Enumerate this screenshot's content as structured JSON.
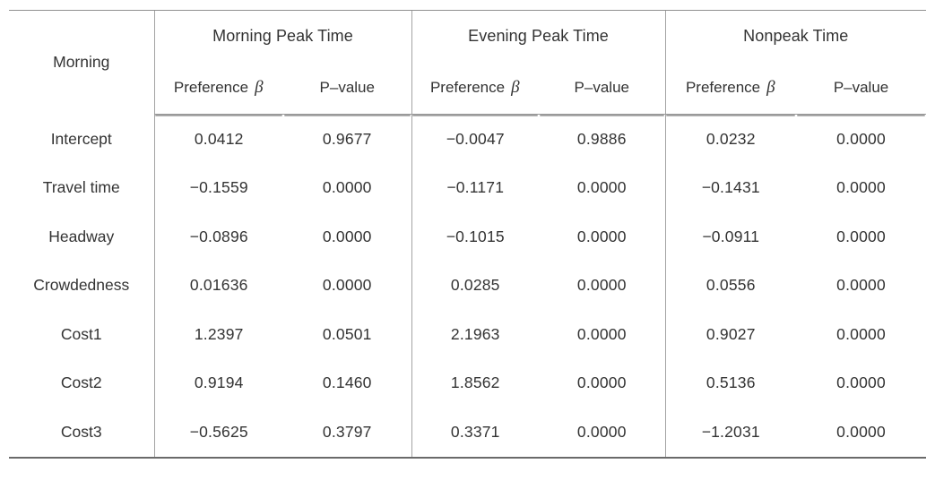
{
  "table": {
    "stub_header": "Morning",
    "column_groups": [
      {
        "label": "Morning  Peak  Time"
      },
      {
        "label": "Evening  Peak  Time"
      },
      {
        "label": "Nonpeak  Time"
      }
    ],
    "sub_headers": {
      "preference": "Preference",
      "beta_symbol": "β",
      "pvalue": "P–value"
    },
    "rows": [
      {
        "label": "Intercept",
        "cells": [
          "0.0412",
          "0.9677",
          "−0.0047",
          "0.9886",
          "0.0232",
          "0.0000"
        ]
      },
      {
        "label": "Travel  time",
        "cells": [
          "−0.1559",
          "0.0000",
          "−0.1171",
          "0.0000",
          "−0.1431",
          "0.0000"
        ]
      },
      {
        "label": "Headway",
        "cells": [
          "−0.0896",
          "0.0000",
          "−0.1015",
          "0.0000",
          "−0.0911",
          "0.0000"
        ]
      },
      {
        "label": "Crowdedness",
        "cells": [
          "0.01636",
          "0.0000",
          "0.0285",
          "0.0000",
          "0.0556",
          "0.0000"
        ]
      },
      {
        "label": "Cost1",
        "cells": [
          "1.2397",
          "0.0501",
          "2.1963",
          "0.0000",
          "0.9027",
          "0.0000"
        ]
      },
      {
        "label": "Cost2",
        "cells": [
          "0.9194",
          "0.1460",
          "1.8562",
          "0.0000",
          "0.5136",
          "0.0000"
        ]
      },
      {
        "label": "Cost3",
        "cells": [
          "−0.5625",
          "0.3797",
          "0.3371",
          "0.0000",
          "−1.2031",
          "0.0000"
        ]
      }
    ]
  }
}
